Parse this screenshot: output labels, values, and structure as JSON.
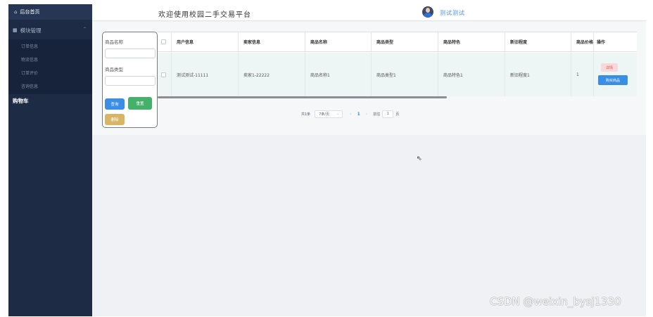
{
  "sidebar": {
    "home_label": "后台首页",
    "home_icon": "home-icon",
    "group_label": "模块管理",
    "group_icon": "grid-icon",
    "items": [
      {
        "label": "订单信息"
      },
      {
        "label": "物流信息"
      },
      {
        "label": "订单评价"
      },
      {
        "label": "咨询信息"
      }
    ],
    "active_label": "购物车"
  },
  "header": {
    "welcome": "欢迎使用校园二手交易平台",
    "username": "测试测试"
  },
  "search": {
    "name_label": "商品名称",
    "type_label": "商品类型",
    "query_label": "查询",
    "reset_label": "重置",
    "delete_label": "删除"
  },
  "table": {
    "columns": [
      "用户信息",
      "卖家信息",
      "商品名称",
      "商品类型",
      "商品特色",
      "新旧程度",
      "商品价格",
      "操作"
    ],
    "rows": [
      {
        "user": "测试测试-11111",
        "seller": "卖家1-22222",
        "name": "商品名称1",
        "type": "商品类型1",
        "feature": "商品特色1",
        "condition": "新旧程度1",
        "price": "1",
        "detail_label": "详情",
        "buy_label": "购买商品"
      }
    ]
  },
  "pager": {
    "total": "共1条",
    "page_size": "7条/页",
    "current": "1",
    "goto_label": "前往",
    "goto_value": "1",
    "page_unit": "页"
  },
  "watermark": "CSDN @weixin_bysj1330",
  "colors": {
    "sidebar_bg": "#1e2b45",
    "primary": "#3a8ee6",
    "success": "#45b06a",
    "warning": "#d8b565",
    "danger_light": "#f8d8d8"
  }
}
